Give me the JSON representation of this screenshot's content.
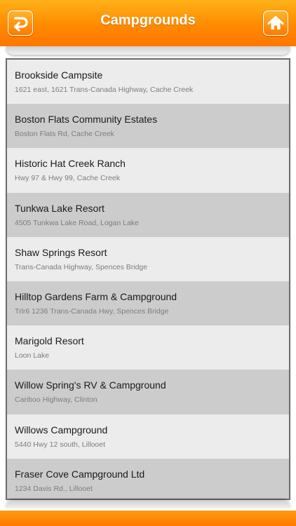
{
  "header": {
    "title": "Campgrounds",
    "back_icon": "back-arrow-icon",
    "home_icon": "home-icon",
    "accent_color": "#ff8a00"
  },
  "campgrounds": [
    {
      "name": "Brookside Campsite",
      "address": "1621 east, 1621 Trans-Canada Highway, Cache Creek"
    },
    {
      "name": "Boston Flats Community Estates",
      "address": "Boston Flats Rd, Cache Creek"
    },
    {
      "name": "Historic Hat Creek Ranch",
      "address": "Hwy 97 & Hwy 99, Cache Creek"
    },
    {
      "name": "Tunkwa Lake Resort",
      "address": "4505 Tunkwa Lake Road, Logan Lake"
    },
    {
      "name": "Shaw Springs Resort",
      "address": "Trans-Canada Highway, Spences Bridge"
    },
    {
      "name": "Hilltop Gardens Farm & Campground",
      "address": "Trlr6 1236 Trans-Canada Hwy, Spences Bridge"
    },
    {
      "name": "Marigold Resort",
      "address": "Loon Lake"
    },
    {
      "name": "Willow Spring's RV & Campground",
      "address": "Cariboo Highway, Clinton"
    },
    {
      "name": "Willows Campground",
      "address": "5440 Hwy 12 south, Lillooet"
    },
    {
      "name": "Fraser Cove Campground Ltd",
      "address": "1234 Davis Rd., Lillooet"
    }
  ]
}
